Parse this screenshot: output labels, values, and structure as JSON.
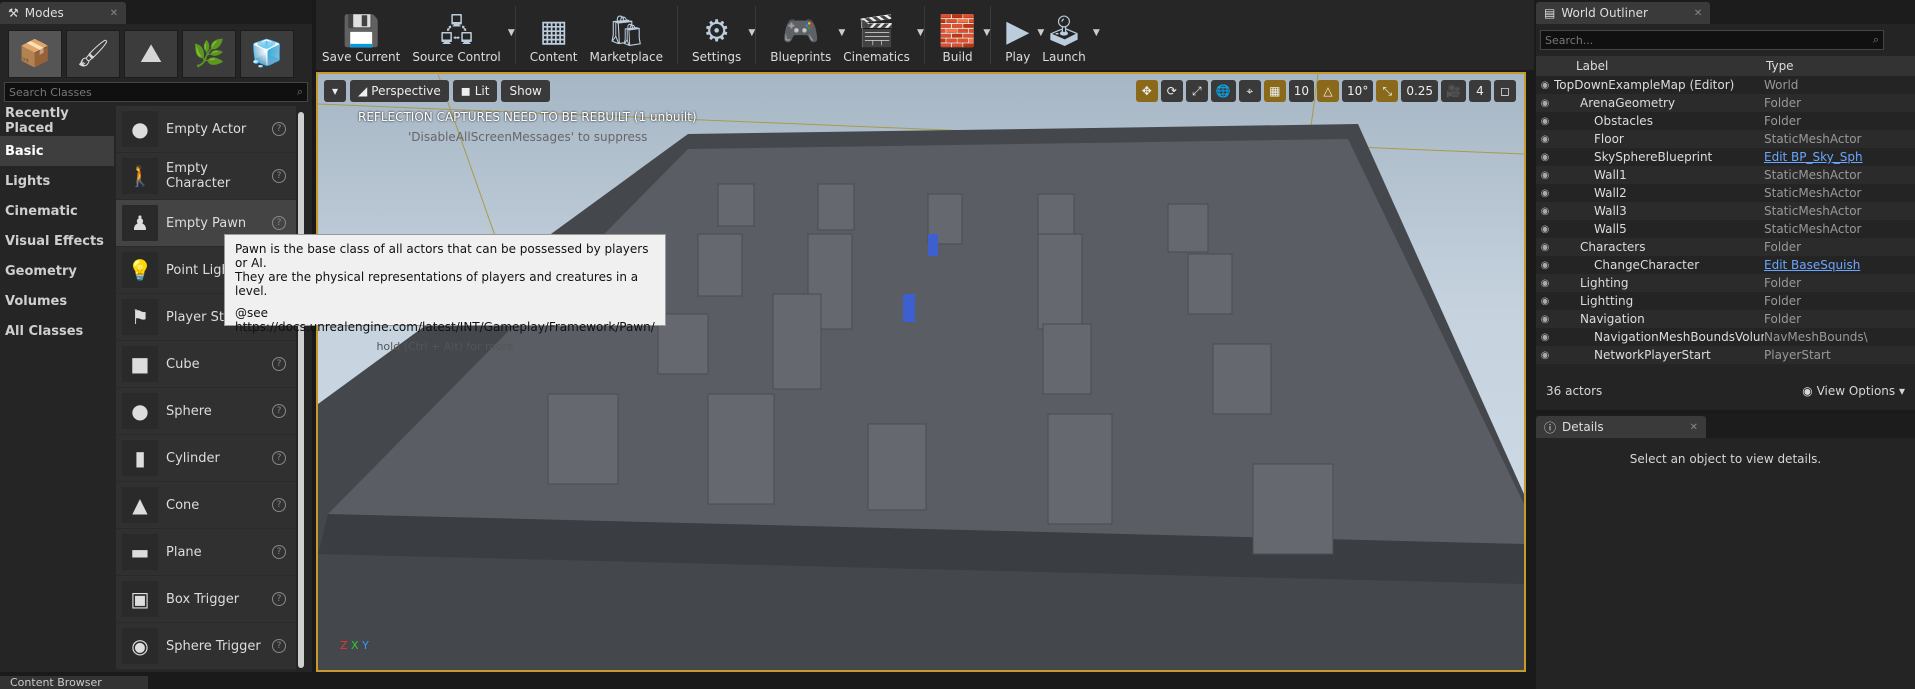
{
  "modes": {
    "tab_title": "Modes",
    "search_placeholder": "Search Classes",
    "categories": [
      "Recently Placed",
      "Basic",
      "Lights",
      "Cinematic",
      "Visual Effects",
      "Geometry",
      "Volumes",
      "All Classes"
    ],
    "items": [
      "Empty Actor",
      "Empty Character",
      "Empty Pawn",
      "Point Light",
      "Player Sta",
      "Cube",
      "Sphere",
      "Cylinder",
      "Cone",
      "Plane",
      "Box Trigger",
      "Sphere Trigger"
    ]
  },
  "toolbar": {
    "buttons": [
      "Save Current",
      "Source Control",
      "Content",
      "Marketplace",
      "Settings",
      "Blueprints",
      "Cinematics",
      "Build",
      "Play",
      "Launch"
    ]
  },
  "viewport": {
    "perspective": "Perspective",
    "lit": "Lit",
    "show": "Show",
    "grid_snap": "10",
    "rot_snap": "10°",
    "scale_snap": "0.25",
    "cam_speed": "4",
    "warning": "REFLECTION CAPTURES NEED TO BE REBUILT (1 unbuilt)",
    "suppress": "'DisableAllScreenMessages' to suppress"
  },
  "tooltip": {
    "line1": "Pawn is the base class of all actors that can be possessed by players or AI.",
    "line2": "They are the physical representations of players and creatures in a level.",
    "line3": "@see https://docs.unrealengine.com/latest/INT/Gameplay/Framework/Pawn/",
    "hint": "hold (Ctrl + Alt) for more"
  },
  "outliner": {
    "tab_title": "World Outliner",
    "search_placeholder": "Search...",
    "col_label": "Label",
    "col_type": "Type",
    "rows": [
      {
        "label": "TopDownExampleMap (Editor)",
        "type": "World"
      },
      {
        "label": "ArenaGeometry",
        "type": "Folder"
      },
      {
        "label": "Obstacles",
        "type": "Folder"
      },
      {
        "label": "Floor",
        "type": "StaticMeshActor"
      },
      {
        "label": "SkySphereBlueprint",
        "type": "Edit BP_Sky_Sph"
      },
      {
        "label": "Wall1",
        "type": "StaticMeshActor"
      },
      {
        "label": "Wall2",
        "type": "StaticMeshActor"
      },
      {
        "label": "Wall3",
        "type": "StaticMeshActor"
      },
      {
        "label": "Wall5",
        "type": "StaticMeshActor"
      },
      {
        "label": "Characters",
        "type": "Folder"
      },
      {
        "label": "ChangeCharacter",
        "type": "Edit BaseSquish"
      },
      {
        "label": "Lighting",
        "type": "Folder"
      },
      {
        "label": "Lightting",
        "type": "Folder"
      },
      {
        "label": "Navigation",
        "type": "Folder"
      },
      {
        "label": "NavigationMeshBoundsVolume",
        "type": "NavMeshBounds\\"
      },
      {
        "label": "NetworkPlayerStart",
        "type": "PlayerStart"
      }
    ],
    "count": "36 actors",
    "view_options": "View Options"
  },
  "details": {
    "tab_title": "Details",
    "empty": "Select an object to view details."
  },
  "content_browser": "Content Browser"
}
